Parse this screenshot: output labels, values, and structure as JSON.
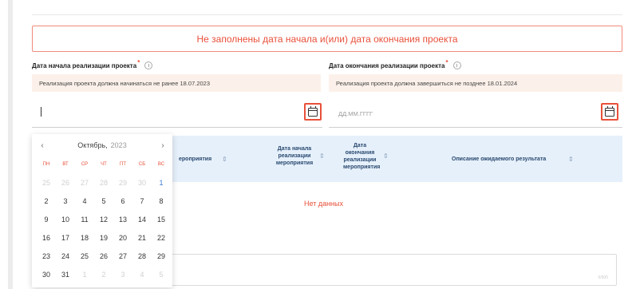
{
  "error_banner": "Не заполнены дата начала и(или) дата окончания проекта",
  "start": {
    "label": "Дата начала реализации проекта",
    "required_mark": "*",
    "hint": "Реализация проекта должна начинаться не ранее 18.07.2023",
    "value": ""
  },
  "end": {
    "label": "Дата окончания реализации проекта",
    "required_mark": "*",
    "hint": "Реализация проекта должна завершиться не позднее 18.01.2024",
    "placeholder": "ДД.ММ.ГГГГ"
  },
  "table": {
    "col_name": "ероприятия",
    "col_start": [
      "Дата начала",
      "реализации",
      "мероприятия"
    ],
    "col_end": [
      "Дата",
      "окончания",
      "реализации",
      "мероприятия"
    ],
    "col_desc": "Описание ожидаемого результата",
    "sort_icon": "sort-icon",
    "sort_glyph": "⇕",
    "empty": "Нет данных"
  },
  "calendar": {
    "month": "Октябрь,",
    "year": "2023",
    "prev": "‹",
    "next": "›",
    "weekdays": [
      "пн",
      "вт",
      "ср",
      "чт",
      "пт",
      "сб",
      "вс"
    ],
    "days": [
      {
        "d": "25",
        "m": true
      },
      {
        "d": "26",
        "m": true
      },
      {
        "d": "27",
        "m": true
      },
      {
        "d": "28",
        "m": true
      },
      {
        "d": "29",
        "m": true
      },
      {
        "d": "30",
        "m": true
      },
      {
        "d": "1",
        "f": true
      },
      {
        "d": "2"
      },
      {
        "d": "3"
      },
      {
        "d": "4"
      },
      {
        "d": "5"
      },
      {
        "d": "6"
      },
      {
        "d": "7"
      },
      {
        "d": "8"
      },
      {
        "d": "9"
      },
      {
        "d": "10"
      },
      {
        "d": "11"
      },
      {
        "d": "12"
      },
      {
        "d": "13"
      },
      {
        "d": "14"
      },
      {
        "d": "15"
      },
      {
        "d": "16"
      },
      {
        "d": "17"
      },
      {
        "d": "18"
      },
      {
        "d": "19"
      },
      {
        "d": "20"
      },
      {
        "d": "21"
      },
      {
        "d": "22"
      },
      {
        "d": "23"
      },
      {
        "d": "24"
      },
      {
        "d": "25"
      },
      {
        "d": "26"
      },
      {
        "d": "27"
      },
      {
        "d": "28"
      },
      {
        "d": "29"
      },
      {
        "d": "30"
      },
      {
        "d": "31"
      },
      {
        "d": "1",
        "m": true
      },
      {
        "d": "2",
        "m": true
      },
      {
        "d": "3",
        "m": true
      },
      {
        "d": "4",
        "m": true
      },
      {
        "d": "5",
        "m": true
      }
    ]
  },
  "textarea": {
    "counter": "0/500"
  },
  "colors": {
    "error": "#e8503a",
    "accent": "#3a7bd5",
    "table_header": "#e6f0fb",
    "hint_bg": "#fcf1ea"
  }
}
